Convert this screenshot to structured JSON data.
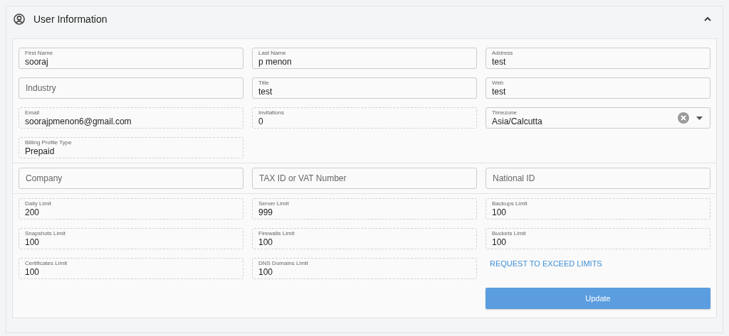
{
  "panel": {
    "title": "User Information",
    "expanded": true
  },
  "sections": [
    {
      "fields": [
        {
          "kind": "text",
          "label": "First Name",
          "value": "sooraj"
        },
        {
          "kind": "text",
          "label": "Last Name",
          "value": "p menon"
        },
        {
          "kind": "text",
          "label": "Address",
          "value": "test"
        },
        {
          "kind": "empty",
          "placeholder": "Industry"
        },
        {
          "kind": "text",
          "label": "Title",
          "value": "test"
        },
        {
          "kind": "text",
          "label": "Web",
          "value": "test"
        },
        {
          "kind": "readonly",
          "label": "Email",
          "value": "soorajpmenon6@gmail.com"
        },
        {
          "kind": "readonly",
          "label": "Invitations",
          "value": "0"
        },
        {
          "kind": "select",
          "label": "Timezone",
          "value": "Asia/Calcutta"
        },
        {
          "kind": "readonly",
          "label": "Billing Profile Type",
          "value": "Prepaid"
        }
      ]
    },
    {
      "fields": [
        {
          "kind": "empty",
          "placeholder": "Company"
        },
        {
          "kind": "empty",
          "placeholder": "TAX ID or VAT Number"
        },
        {
          "kind": "empty",
          "placeholder": "National ID"
        }
      ]
    },
    {
      "fields": [
        {
          "kind": "readonly",
          "label": "Daily Limit",
          "value": "200"
        },
        {
          "kind": "readonly",
          "label": "Server Limit",
          "value": "999"
        },
        {
          "kind": "readonly",
          "label": "Backups Limit",
          "value": "100"
        },
        {
          "kind": "readonly",
          "label": "Snapshots Limit",
          "value": "100"
        },
        {
          "kind": "readonly",
          "label": "Firewalls Limit",
          "value": "100"
        },
        {
          "kind": "readonly",
          "label": "Buckets Limit",
          "value": "100"
        },
        {
          "kind": "readonly",
          "label": "Certificates Limit",
          "value": "100"
        },
        {
          "kind": "readonly",
          "label": "DNS Domains Limit",
          "value": "100"
        }
      ],
      "link": "REQUEST TO EXCEED LIMITS"
    }
  ],
  "button": "Update"
}
